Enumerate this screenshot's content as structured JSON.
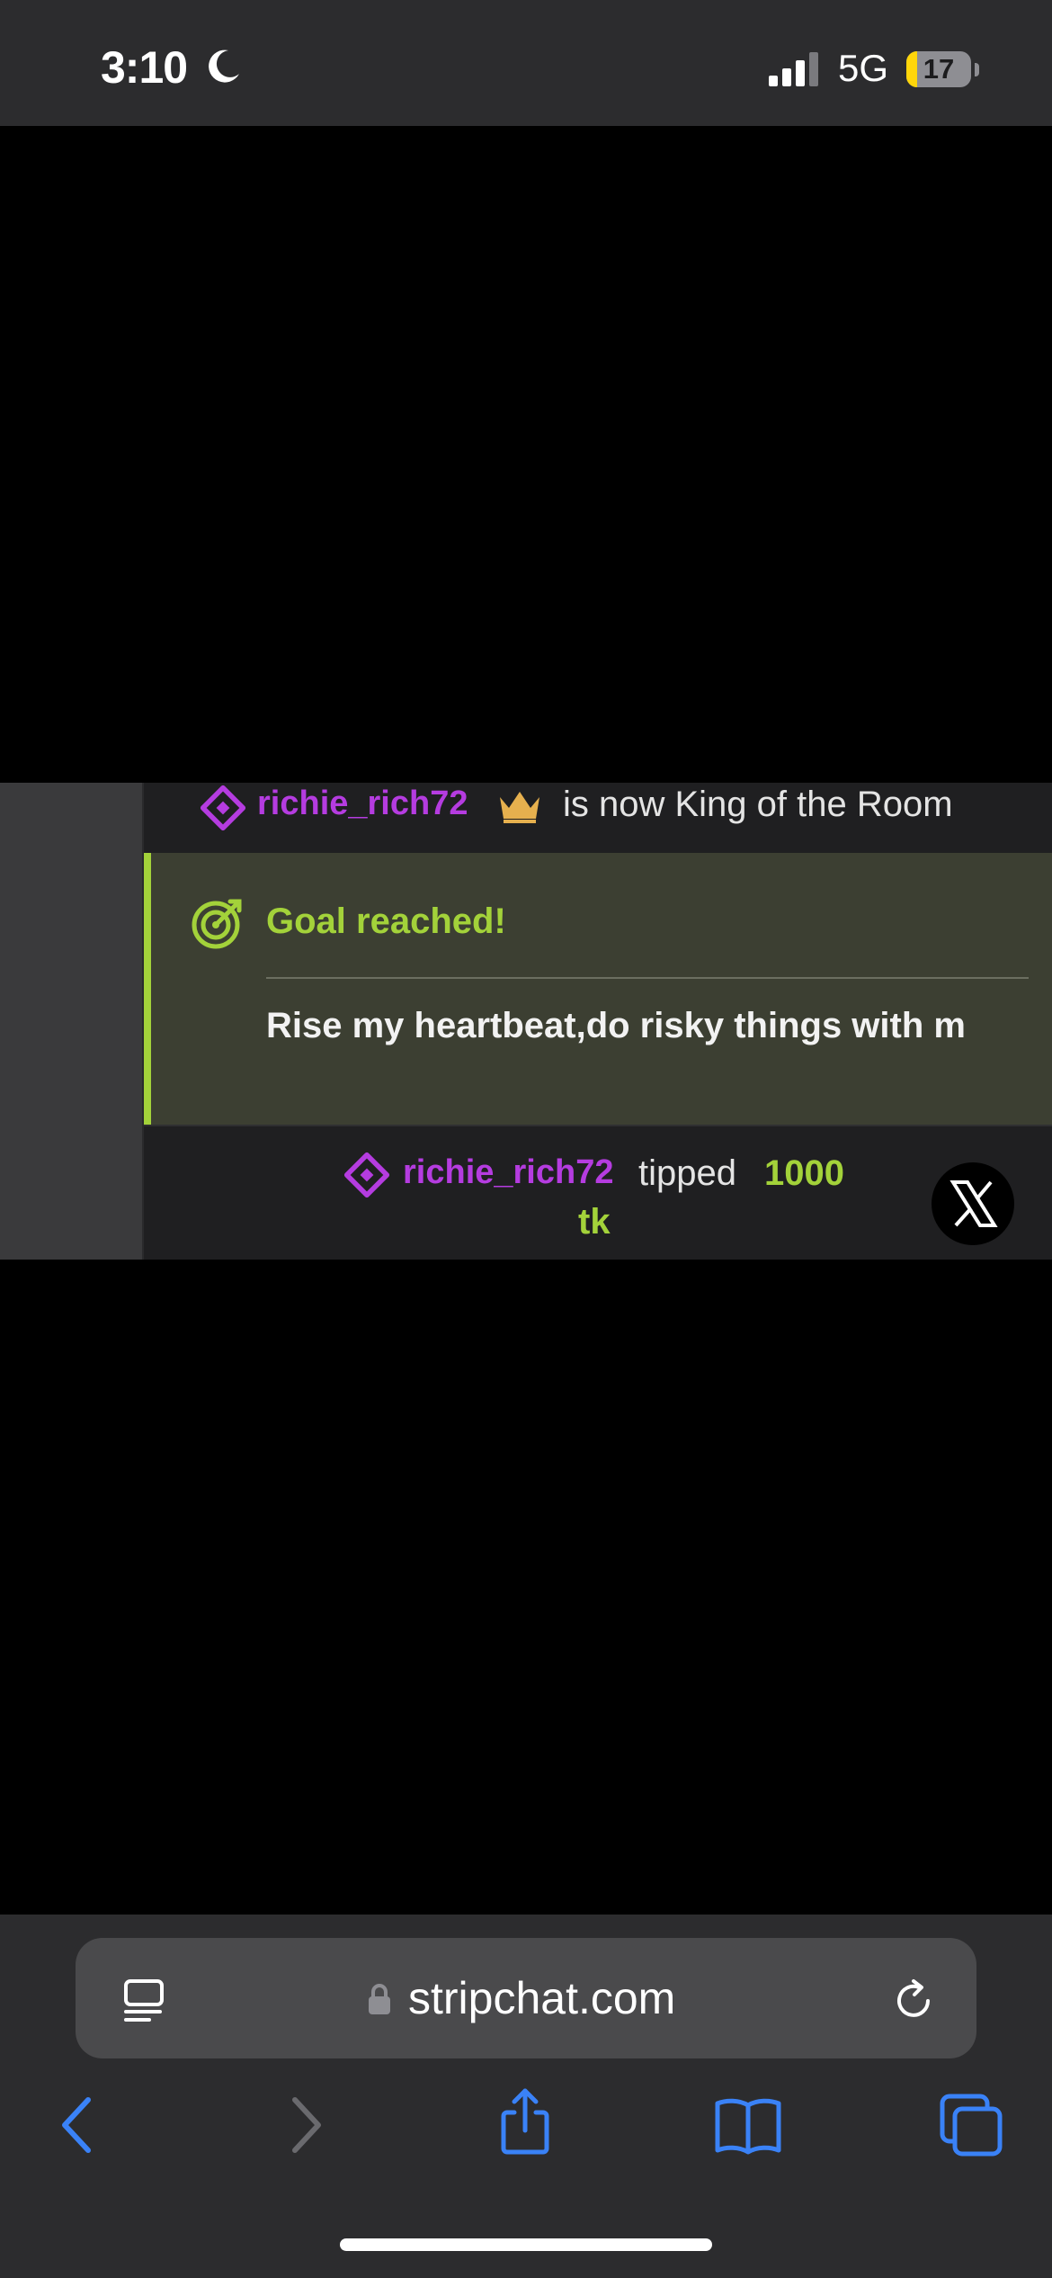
{
  "status_bar": {
    "time": "3:10",
    "network": "5G",
    "battery_level": "17",
    "battery_fraction": 0.17,
    "focus_icon": "moon-icon"
  },
  "chat": {
    "king_event": {
      "username": "richie_rich72",
      "text": "is now King of the Room",
      "icons": [
        "diamond-icon",
        "crown-icon"
      ]
    },
    "goal": {
      "title": "Goal reached!",
      "description": "Rise my heartbeat,do risky things with m",
      "accent_color": "#a3d23a"
    },
    "tip_event": {
      "username": "richie_rich72",
      "verb": "tipped",
      "amount": "1000",
      "unit": "tk"
    },
    "username_color": "#b53ce0",
    "close_icon": "x-logo-icon"
  },
  "browser": {
    "url": "stripchat.com",
    "icons": [
      "reader-icon",
      "lock-icon",
      "reload-icon",
      "back-icon",
      "forward-icon",
      "share-icon",
      "bookmarks-icon",
      "tabs-icon"
    ],
    "accent_color": "#3a82f7"
  }
}
